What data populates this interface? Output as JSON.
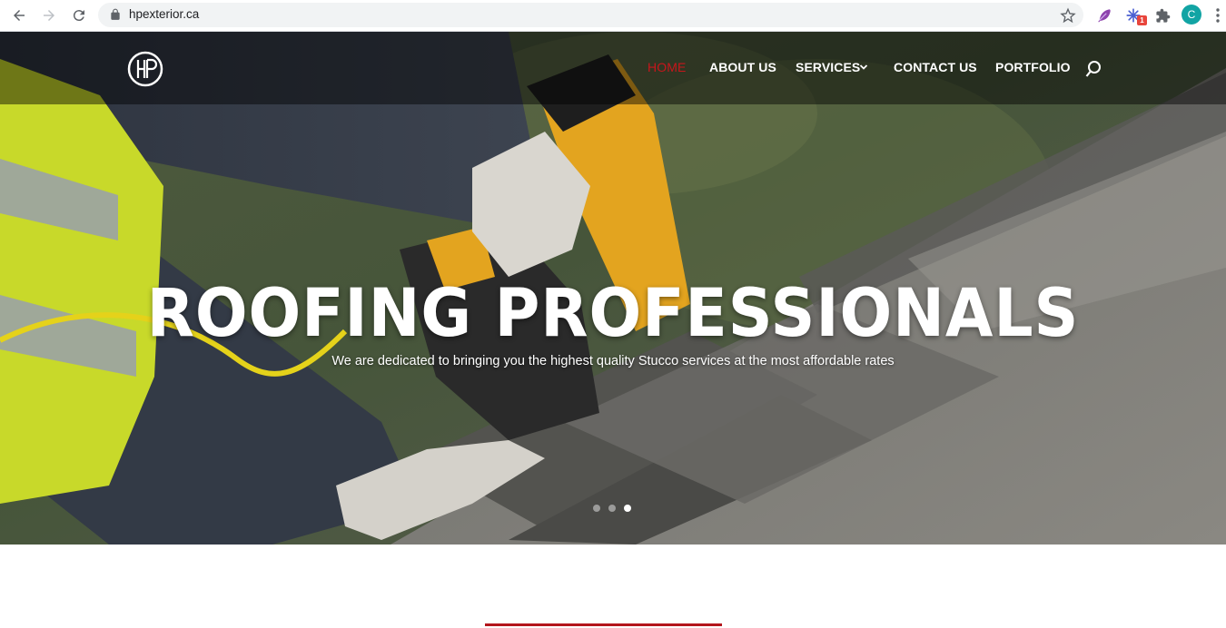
{
  "browser": {
    "url": "hpexterior.ca",
    "profile_initial": "C",
    "extension_badge": "1"
  },
  "site": {
    "logo_text": "HP",
    "nav": [
      {
        "label": "HOME",
        "active": true
      },
      {
        "label": "ABOUT US",
        "active": false
      },
      {
        "label": "SERVICES",
        "active": false,
        "dropdown": true
      },
      {
        "label": "CONTACT US",
        "active": false
      },
      {
        "label": "PORTFOLIO",
        "active": false
      }
    ]
  },
  "hero": {
    "title": "ROOFING PROFESSIONALS",
    "subtitle": "We are dedicated to bringing you the highest quality Stucco services at the most affordable rates",
    "slides_total": 3,
    "slide_active": 3
  },
  "colors": {
    "accent_red": "#c7161b",
    "divider_red": "#b3161c"
  }
}
